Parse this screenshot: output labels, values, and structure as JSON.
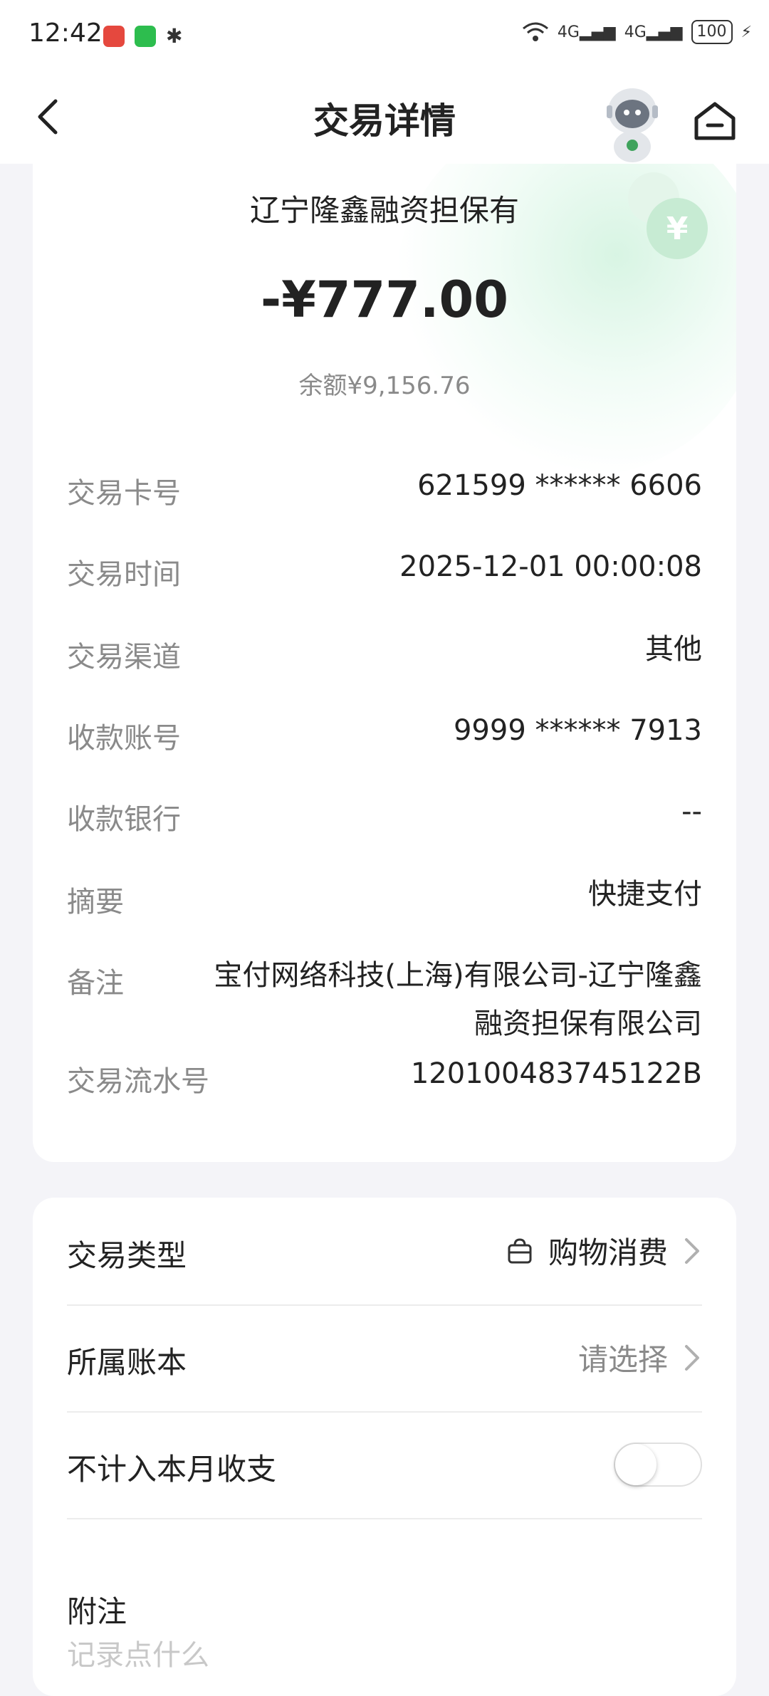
{
  "status_bar": {
    "time": "12:42",
    "net1": "4G",
    "net2": "4G",
    "battery": "100"
  },
  "header": {
    "title": "交易详情"
  },
  "transaction": {
    "merchant": "辽宁隆鑫融资担保有",
    "amount": "-¥777.00",
    "balance": "余额¥9,156.76",
    "details": [
      {
        "label": "交易卡号",
        "value": "621599 ****** 6606"
      },
      {
        "label": "交易时间",
        "value": "2025-12-01 00:00:08"
      },
      {
        "label": "交易渠道",
        "value": "其他"
      },
      {
        "label": "收款账号",
        "value": "9999 ****** 7913"
      },
      {
        "label": "收款银行",
        "value": "--"
      },
      {
        "label": "摘要",
        "value": "快捷支付"
      },
      {
        "label": "备注",
        "value": "宝付网络科技(上海)有限公司-辽宁隆鑫融资担保有限公司"
      },
      {
        "label": "交易流水号",
        "value": "120100483745122B"
      }
    ]
  },
  "options": {
    "type_label": "交易类型",
    "type_value": "购物消费",
    "book_label": "所属账本",
    "book_value": "请选择",
    "exclude_label": "不计入本月收支",
    "exclude_on": false,
    "note_title": "附注",
    "note_placeholder": "记录点什么"
  },
  "colors": {
    "accent_green": "#c7ebd3",
    "background": "#f4f4f8"
  }
}
